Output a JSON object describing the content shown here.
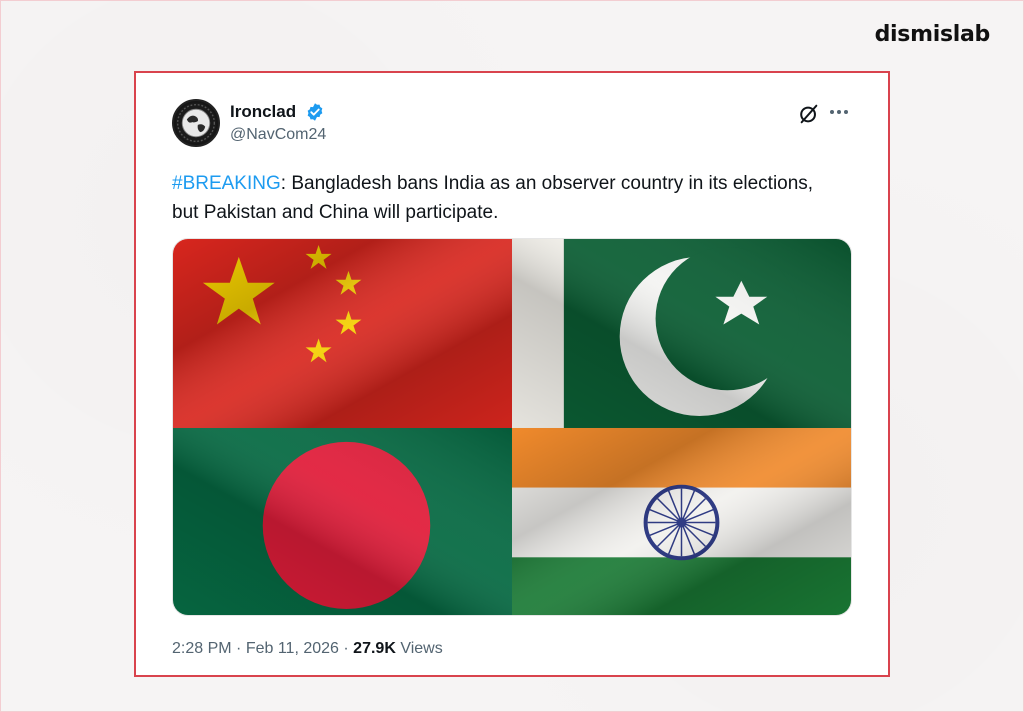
{
  "brand": {
    "logo_text": "dismislab"
  },
  "tweet": {
    "author": {
      "display_name": "Ironclad",
      "handle": "@NavCom24",
      "verified": true
    },
    "text": {
      "hashtag": "#BREAKING",
      "body": ": Bangladesh bans India as an observer country in its elections, but Pakistan and China will participate."
    },
    "media": {
      "flags": [
        "china-flag",
        "pakistan-flag",
        "bangladesh-flag",
        "india-flag"
      ]
    },
    "time": "2:28 PM",
    "separator": "·",
    "date": "Feb 11, 2026",
    "views_count": "27.9K",
    "views_label": "Views"
  },
  "colors": {
    "frame_border": "#d9434d",
    "link_blue": "#1d9bf0",
    "text_primary": "#0f1419",
    "text_secondary": "#536471"
  }
}
